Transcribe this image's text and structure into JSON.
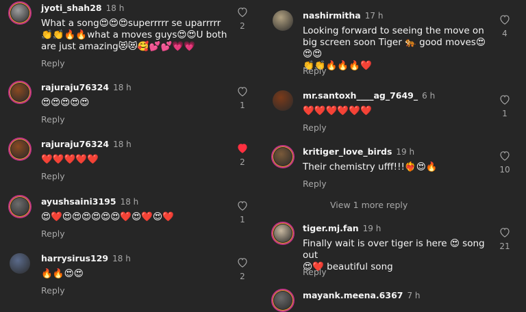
{
  "left_comments": [
    {
      "username": "jyoti_shah28",
      "time": "18 h",
      "text": "What a song😍😍😍superrrrr se uparrrrr👏👏🔥🔥what a moves guys😍😍U both are just amazing😻😻🥰💕💕💗💗",
      "reply": "Reply",
      "likes": "2",
      "liked": false,
      "avatar_color": "#9e9e9e",
      "ring": true
    },
    {
      "username": "rajuraju76324",
      "time": "18 h",
      "text": "😍😍😍😍😍",
      "reply": "Reply",
      "likes": "1",
      "liked": false,
      "avatar_color": "#8a4a22",
      "ring": true
    },
    {
      "username": "rajuraju76324",
      "time": "18 h",
      "text": "❤️❤️❤️❤️❤️",
      "reply": "Reply",
      "likes": "2",
      "liked": true,
      "avatar_color": "#8a4a22",
      "ring": true
    },
    {
      "username": "ayushsaini3195",
      "time": "18 h",
      "text": "😍❤️😍😍😍😍😍😍❤️😍❤️😍❤️",
      "reply": "Reply",
      "likes": "1",
      "liked": false,
      "avatar_color": "#6d6d6d",
      "ring": true
    },
    {
      "username": "harrysirus129",
      "time": "18 h",
      "text": "🔥🔥😍😍",
      "reply": "Reply",
      "likes": "2",
      "liked": false,
      "avatar_color": "#5a6a8a",
      "ring": false
    }
  ],
  "right_comments": [
    {
      "username": "nashirmitha",
      "time": "17 h",
      "text": "Looking forward to seeing the move on big screen soon Tiger 🐅 good moves😍😍😍\n👏👏🔥🔥🔥❤️",
      "reply": "Reply",
      "likes": "4",
      "liked": false,
      "avatar_color": "#b0a080",
      "ring": false
    },
    {
      "username": "mr.santoxh____ag_7649_",
      "time": "6 h",
      "text": "❤️❤️❤️❤️❤️❤️",
      "reply": "Reply",
      "likes": "1",
      "liked": false,
      "avatar_color": "#7a3a1a",
      "ring": false
    },
    {
      "username": "kritiger_love_birds",
      "time": "19 h",
      "text": "Their chemistry ufff!!!❤️‍🔥😍🔥",
      "reply": "Reply",
      "likes": "10",
      "liked": false,
      "avatar_color": "#7a5a3a",
      "ring": true
    },
    {
      "username": "tiger.mj.fan",
      "time": "19 h",
      "text": "Finally wait is over tiger is here 😍 song out\n😍❤️ beautiful song",
      "reply": "Reply",
      "likes": "21",
      "liked": false,
      "avatar_color": "#c8b8a0",
      "ring": true
    },
    {
      "username": "mayank.meena.6367",
      "time": "7 h",
      "text": "",
      "reply": "",
      "likes": "",
      "liked": false,
      "avatar_color": "#6a6a6a",
      "ring": true
    }
  ],
  "view_more": "View 1 more reply",
  "colors": {
    "background": "#262626",
    "secondary": "#a8a8a8",
    "liked": "#ff3040"
  }
}
